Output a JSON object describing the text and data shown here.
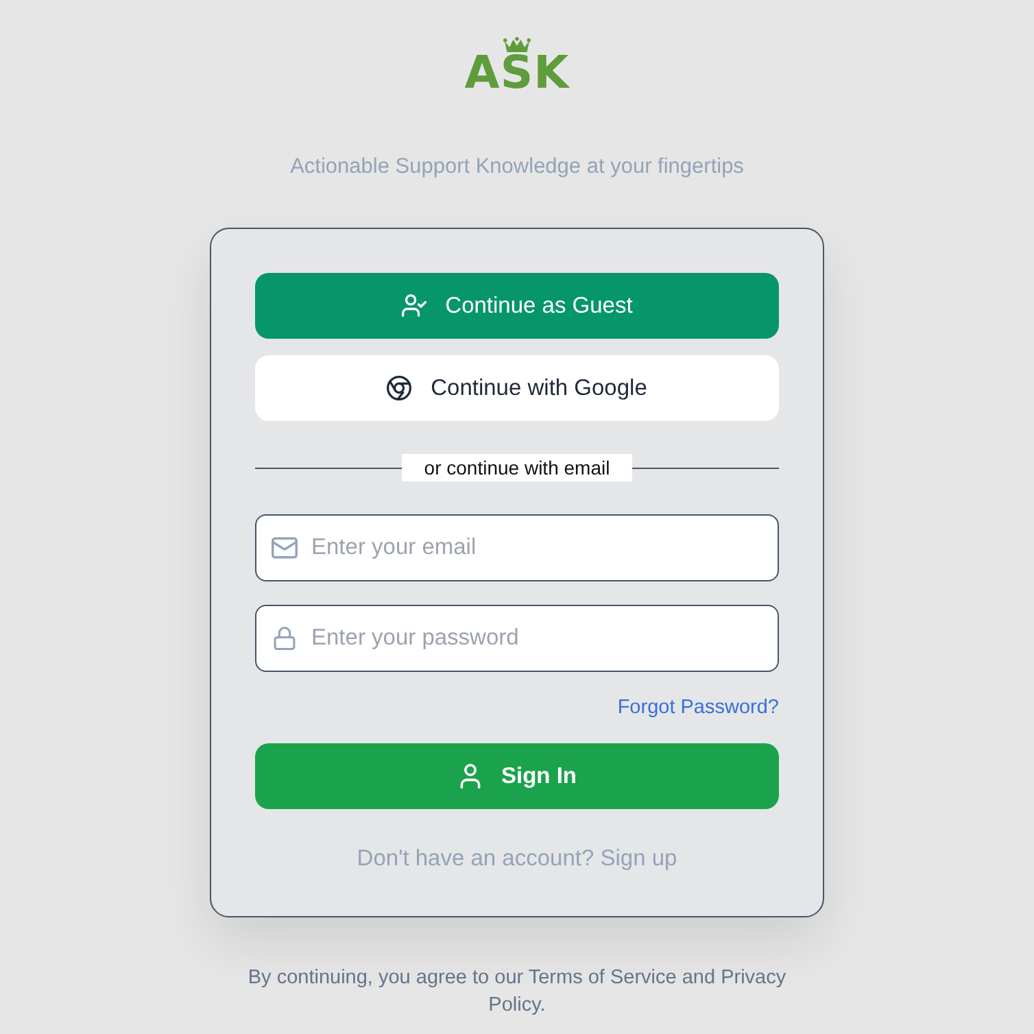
{
  "logo": {
    "text": "ASK"
  },
  "tagline": "Actionable Support Knowledge at your fingertips",
  "card": {
    "buttons": [
      {
        "kind": "guest",
        "label": "Continue as Guest"
      },
      {
        "kind": "google",
        "label": "Continue with Google"
      }
    ],
    "divider": "or continue with email",
    "fields": [
      {
        "kind": "email",
        "placeholder": "Enter your email"
      },
      {
        "kind": "password",
        "placeholder": "Enter your password"
      }
    ],
    "forgot_link": "Forgot Password?",
    "submit": {
      "label": "Sign In"
    },
    "signup_prompt": "Don't have an account? Sign up"
  },
  "footer": "By continuing, you agree to our Terms of Service and Privacy Policy."
}
